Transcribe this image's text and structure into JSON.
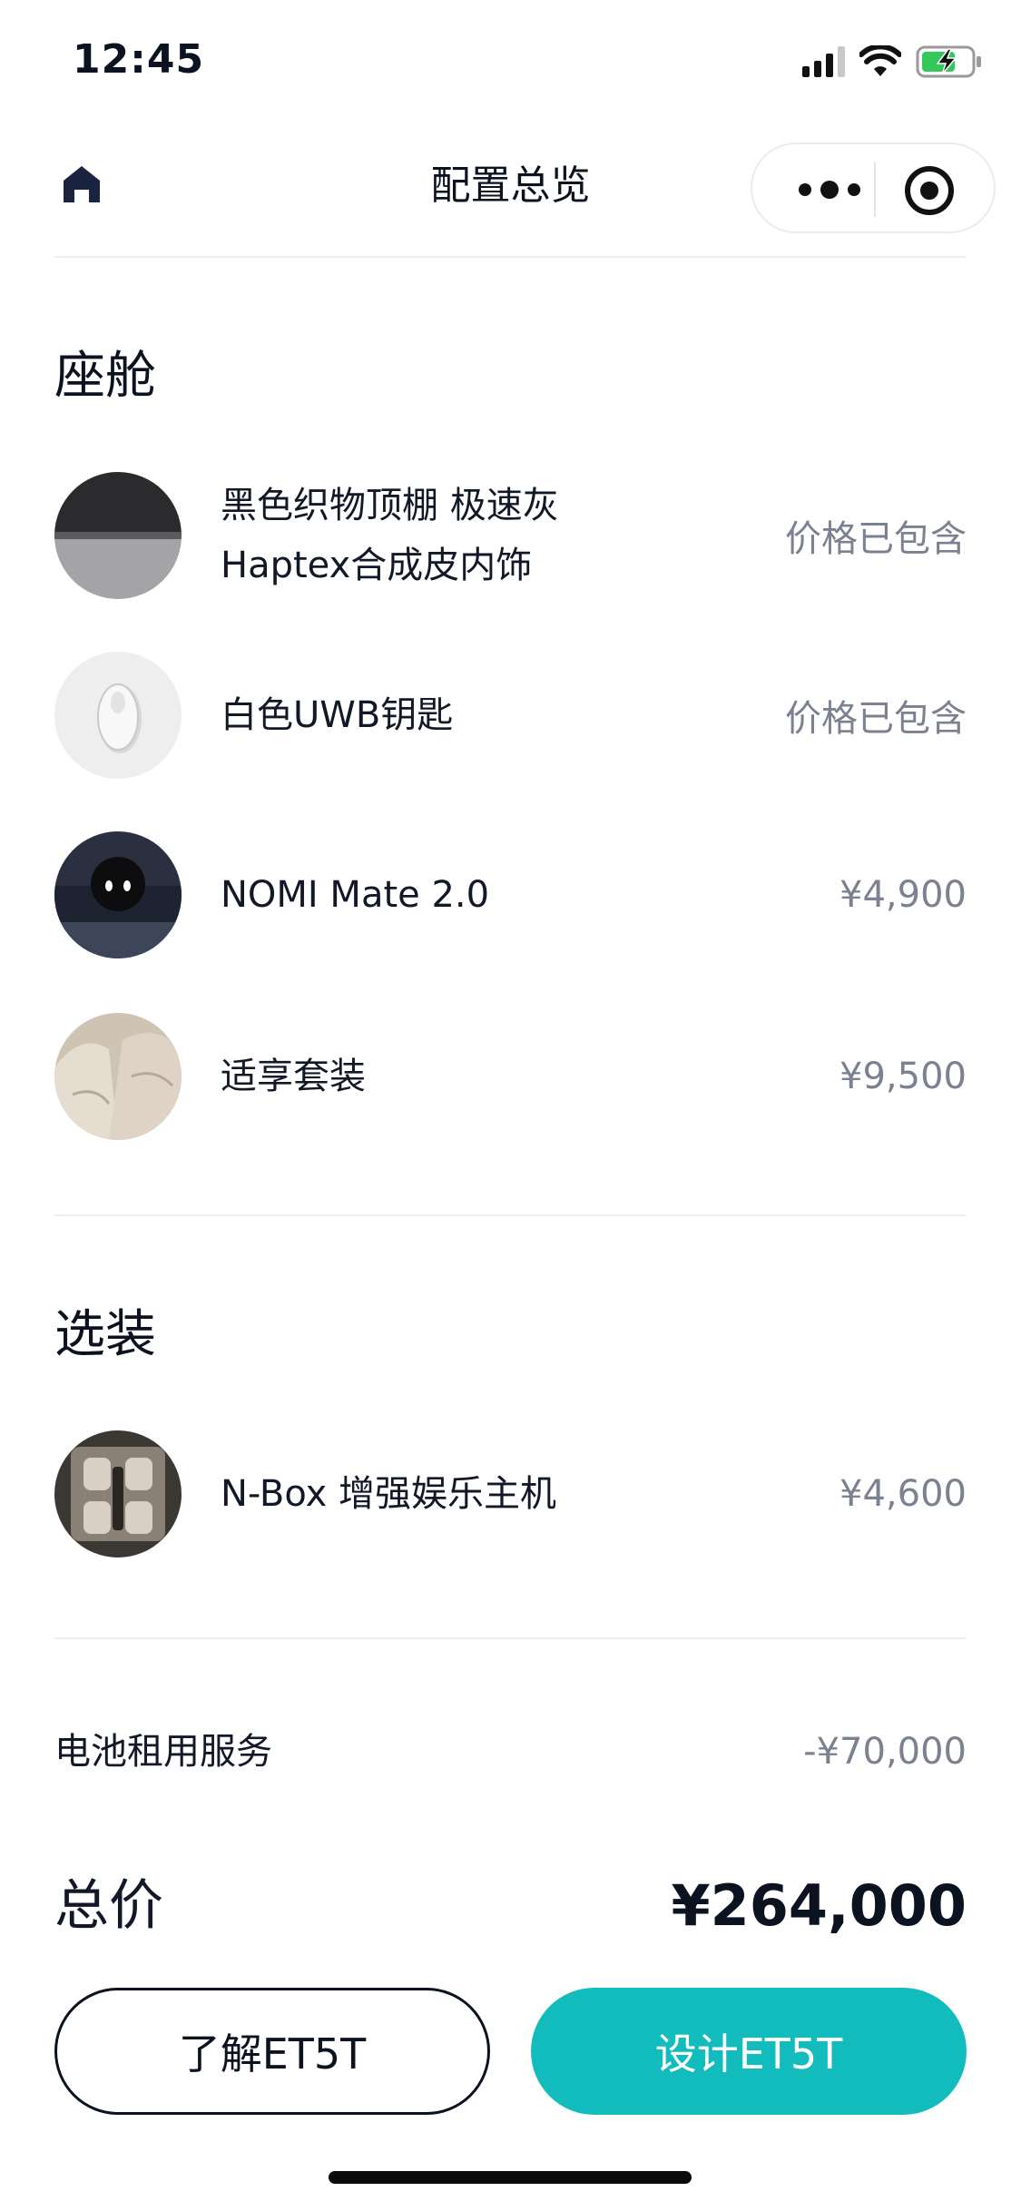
{
  "status_bar": {
    "time": "12:45"
  },
  "nav": {
    "title": "配置总览"
  },
  "cabin": {
    "title": "座舱",
    "items": [
      {
        "name_line1": "黑色织物顶棚 极速灰",
        "name_line2": "Haptex合成皮内饰",
        "price": "价格已包含"
      },
      {
        "name_line1": "白色UWB钥匙",
        "name_line2": "",
        "price": "价格已包含"
      },
      {
        "name_line1": "NOMI Mate 2.0",
        "name_line2": "",
        "price": "¥4,900"
      },
      {
        "name_line1": "适享套装",
        "name_line2": "",
        "price": "¥9,500"
      }
    ]
  },
  "options": {
    "title": "选装",
    "items": [
      {
        "name_line1": "N-Box 增强娱乐主机",
        "name_line2": "",
        "price": "¥4,600"
      }
    ]
  },
  "battery": {
    "label": "电池租用服务",
    "value": "-¥70,000"
  },
  "total": {
    "label": "总价",
    "value": "¥264,000"
  },
  "buttons": {
    "learn": "了解ET5T",
    "design": "设计ET5T"
  },
  "colors": {
    "accent": "#13bcbc",
    "text": "#0b1220",
    "muted": "#7b8190"
  }
}
